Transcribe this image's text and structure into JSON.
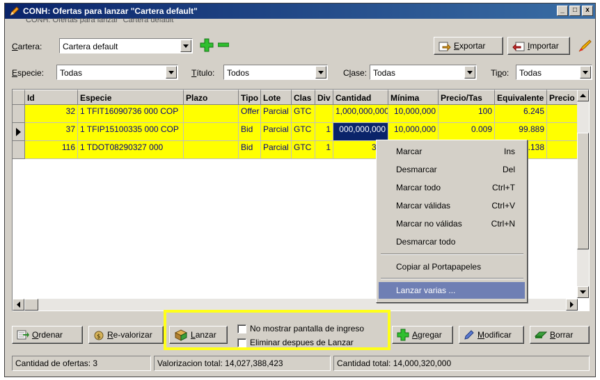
{
  "window": {
    "title": "CONH: Ofertas para lanzar \"Cartera default\"",
    "ghost_title": "CONH: Ofertas para lanzar \"Cartera default\"",
    "controls": [
      "_",
      "□",
      "x"
    ]
  },
  "filters": {
    "cartera_label": "Cartera:",
    "cartera_value": "Cartera default",
    "especie_label": "Especie:",
    "especie_value": "Todas",
    "titulo_label": "Título:",
    "titulo_value": "Todos",
    "clase_label": "Clase:",
    "clase_value": "Todas",
    "tipo_label": "Tipo:",
    "tipo_value": "Todas"
  },
  "toolbar": {
    "exportar_label": "Exportar",
    "importar_label": "Importar"
  },
  "grid": {
    "columns": [
      "Id",
      "Especie",
      "Plazo",
      "Tipo",
      "Lote",
      "Clas",
      "Div",
      "Cantidad",
      "Mínima",
      "Precio/Tas",
      "Equivalente",
      "Precio"
    ],
    "rows": [
      {
        "id": "32",
        "especie": "1 TFIT16090736 000 COP",
        "plazo": "",
        "tipo": "Offer",
        "lote": "Parcial",
        "clas": "GTC",
        "div": "",
        "cantidad": "1,000,000,000",
        "minima": "10,000,000",
        "precio_tas": "100",
        "equivalente": "6.245",
        "precio": ""
      },
      {
        "id": "37",
        "especie": "1 TFIP15100335 000 COP",
        "plazo": "",
        "tipo": "Bid",
        "lote": "Parcial",
        "clas": "GTC",
        "div": "1",
        "cantidad": "000,000,000",
        "minima": "10,000,000",
        "precio_tas": "0.009",
        "equivalente": "99.889",
        "precio": ""
      },
      {
        "id": "116",
        "especie": "1 TDOT08290327 000",
        "plazo": "",
        "tipo": "Bid",
        "lote": "Parcial",
        "clas": "GTC",
        "div": "1",
        "cantidad": "320",
        "minima": "",
        "precio_tas": "",
        "equivalente": "0.138",
        "precio": ""
      }
    ]
  },
  "context_menu": {
    "items": [
      {
        "label": "Marcar",
        "shortcut": "Ins"
      },
      {
        "label": "Desmarcar",
        "shortcut": "Del"
      },
      {
        "label": "Marcar todo",
        "shortcut": "Ctrl+T"
      },
      {
        "label": "Marcar válidas",
        "shortcut": "Ctrl+V"
      },
      {
        "label": "Marcar no válidas",
        "shortcut": "Ctrl+N"
      },
      {
        "label": "Desmarcar todo",
        "shortcut": ""
      },
      {
        "label": "Copiar al Portapapeles",
        "shortcut": ""
      },
      {
        "label": "Lanzar varias ...",
        "shortcut": ""
      }
    ]
  },
  "actions": {
    "ordenar": "Ordenar",
    "revalorizar": "Re-valorizar",
    "lanzar": "Lanzar",
    "no_mostrar": "No mostrar pantalla de ingreso",
    "eliminar": "Eliminar despues de Lanzar",
    "agregar": "Agregar",
    "modificar": "Modificar",
    "borrar": "Borrar"
  },
  "status": {
    "cantidad_ofertas": "Cantidad de ofertas: 3",
    "valorizacion": "Valorizacion total: 14,027,388,423",
    "cantidad_total": "Cantidad total: 14,000,320,000"
  }
}
